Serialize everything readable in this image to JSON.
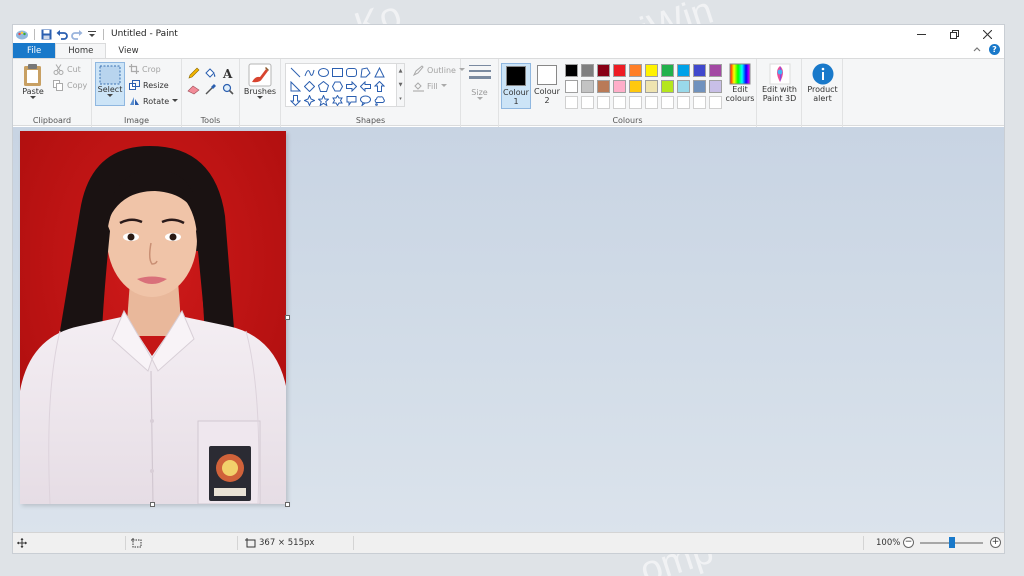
{
  "window": {
    "title": "Untitled - Paint"
  },
  "tabs": [
    {
      "label": "File"
    },
    {
      "label": "Home"
    },
    {
      "label": "View"
    }
  ],
  "clipboard": {
    "group_label": "Clipboard",
    "paste_label": "Paste",
    "cut_label": "Cut",
    "copy_label": "Copy"
  },
  "image": {
    "group_label": "Image",
    "select_label": "Select",
    "crop_label": "Crop",
    "resize_label": "Resize",
    "rotate_label": "Rotate"
  },
  "tools": {
    "group_label": "Tools"
  },
  "brushes": {
    "label": "Brushes"
  },
  "shapes": {
    "group_label": "Shapes",
    "outline_label": "Outline",
    "fill_label": "Fill"
  },
  "size": {
    "label": "Size"
  },
  "colours": {
    "group_label": "Colours",
    "colour1_label": "Colour",
    "colour1_num": "1",
    "colour2_label": "Colour",
    "colour2_num": "2",
    "colour1_value": "#000000",
    "colour2_value": "#ffffff",
    "edit_label": "Edit",
    "edit_label2": "colours",
    "palette_row1": [
      "#000000",
      "#7f7f7f",
      "#880015",
      "#ed1c24",
      "#ff7f27",
      "#fff200",
      "#22b14c",
      "#00a2e8",
      "#3f48cc",
      "#a349a4"
    ],
    "palette_row2": [
      "#ffffff",
      "#c3c3c3",
      "#b97a57",
      "#ffaec9",
      "#ffc90e",
      "#efe4b0",
      "#b5e61d",
      "#99d9ea",
      "#7092be",
      "#c8bfe7"
    ]
  },
  "paint3d": {
    "label": "Edit with",
    "label2": "Paint 3D"
  },
  "product_alert": {
    "label": "Product",
    "label2": "alert"
  },
  "status": {
    "dimensions": "367 × 515px",
    "zoom": "100%"
  }
}
